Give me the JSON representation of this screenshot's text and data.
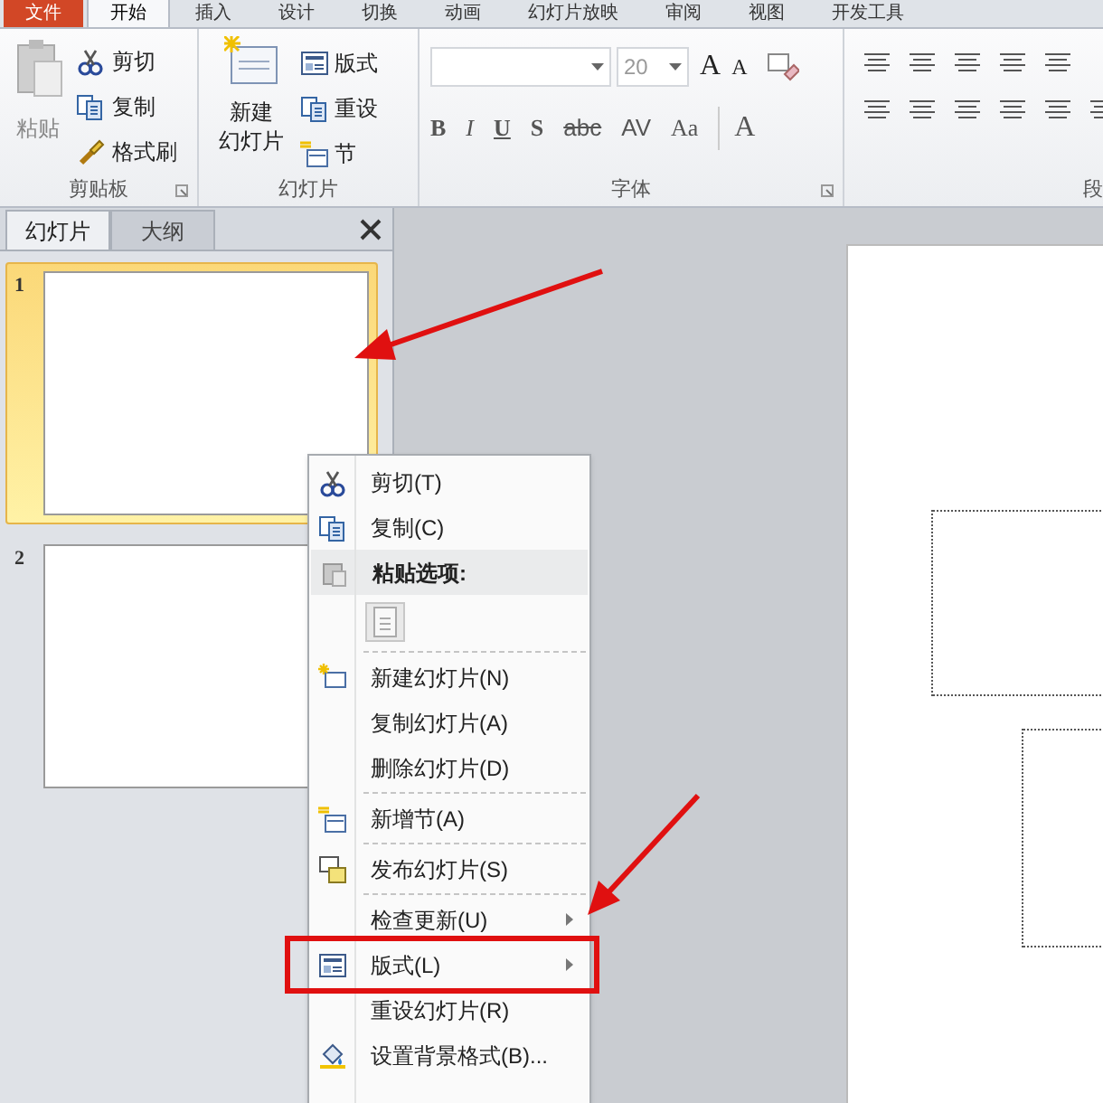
{
  "ribbon_tabs": [
    {
      "label": "文件",
      "selected": false,
      "kind": "file"
    },
    {
      "label": "开始",
      "selected": true,
      "kind": "tab"
    },
    {
      "label": "插入",
      "selected": false,
      "kind": "tab"
    },
    {
      "label": "设计",
      "selected": false,
      "kind": "tab"
    },
    {
      "label": "切换",
      "selected": false,
      "kind": "tab"
    },
    {
      "label": "动画",
      "selected": false,
      "kind": "tab"
    },
    {
      "label": "幻灯片放映",
      "selected": false,
      "kind": "tab"
    },
    {
      "label": "审阅",
      "selected": false,
      "kind": "tab"
    },
    {
      "label": "视图",
      "selected": false,
      "kind": "tab"
    },
    {
      "label": "开发工具",
      "selected": false,
      "kind": "tab"
    }
  ],
  "clipboard": {
    "paste": "粘贴",
    "cut": "剪切",
    "copy": "复制",
    "format_painter": "格式刷",
    "label": "剪贴板"
  },
  "slides_group": {
    "new_slide_1": "新建",
    "new_slide_2": "幻灯片",
    "layout": "版式",
    "reset": "重设",
    "section": "节",
    "label": "幻灯片"
  },
  "font_group": {
    "font_size": "20",
    "size_buttons": [
      "A",
      "A"
    ],
    "format_buttons": [
      "B",
      "I",
      "U",
      "S",
      "abc",
      "AV",
      "Aa"
    ],
    "color_button": "A",
    "label": "字体"
  },
  "paragraph_group": {
    "label": "段"
  },
  "panel_tabs": [
    {
      "label": "幻灯片",
      "selected": true
    },
    {
      "label": "大纲",
      "selected": false
    }
  ],
  "thumbnails": [
    {
      "number": "1",
      "selected": true
    },
    {
      "number": "2",
      "selected": false
    }
  ],
  "context_menu": [
    {
      "kind": "item",
      "label": "剪切(T)"
    },
    {
      "kind": "item",
      "label": "复制(C)"
    },
    {
      "kind": "header",
      "label": "粘贴选项:"
    },
    {
      "kind": "paste_option"
    },
    {
      "kind": "item",
      "label": "新建幻灯片(N)"
    },
    {
      "kind": "item",
      "label": "复制幻灯片(A)"
    },
    {
      "kind": "item",
      "label": "删除幻灯片(D)"
    },
    {
      "kind": "item",
      "label": "新增节(A)"
    },
    {
      "kind": "item",
      "label": "发布幻灯片(S)"
    },
    {
      "kind": "submenu",
      "label": "检查更新(U)"
    },
    {
      "kind": "submenu",
      "label": "版式(L)"
    },
    {
      "kind": "item",
      "label": "重设幻灯片(R)"
    },
    {
      "kind": "item",
      "label": "设置背景格式(B)..."
    }
  ]
}
